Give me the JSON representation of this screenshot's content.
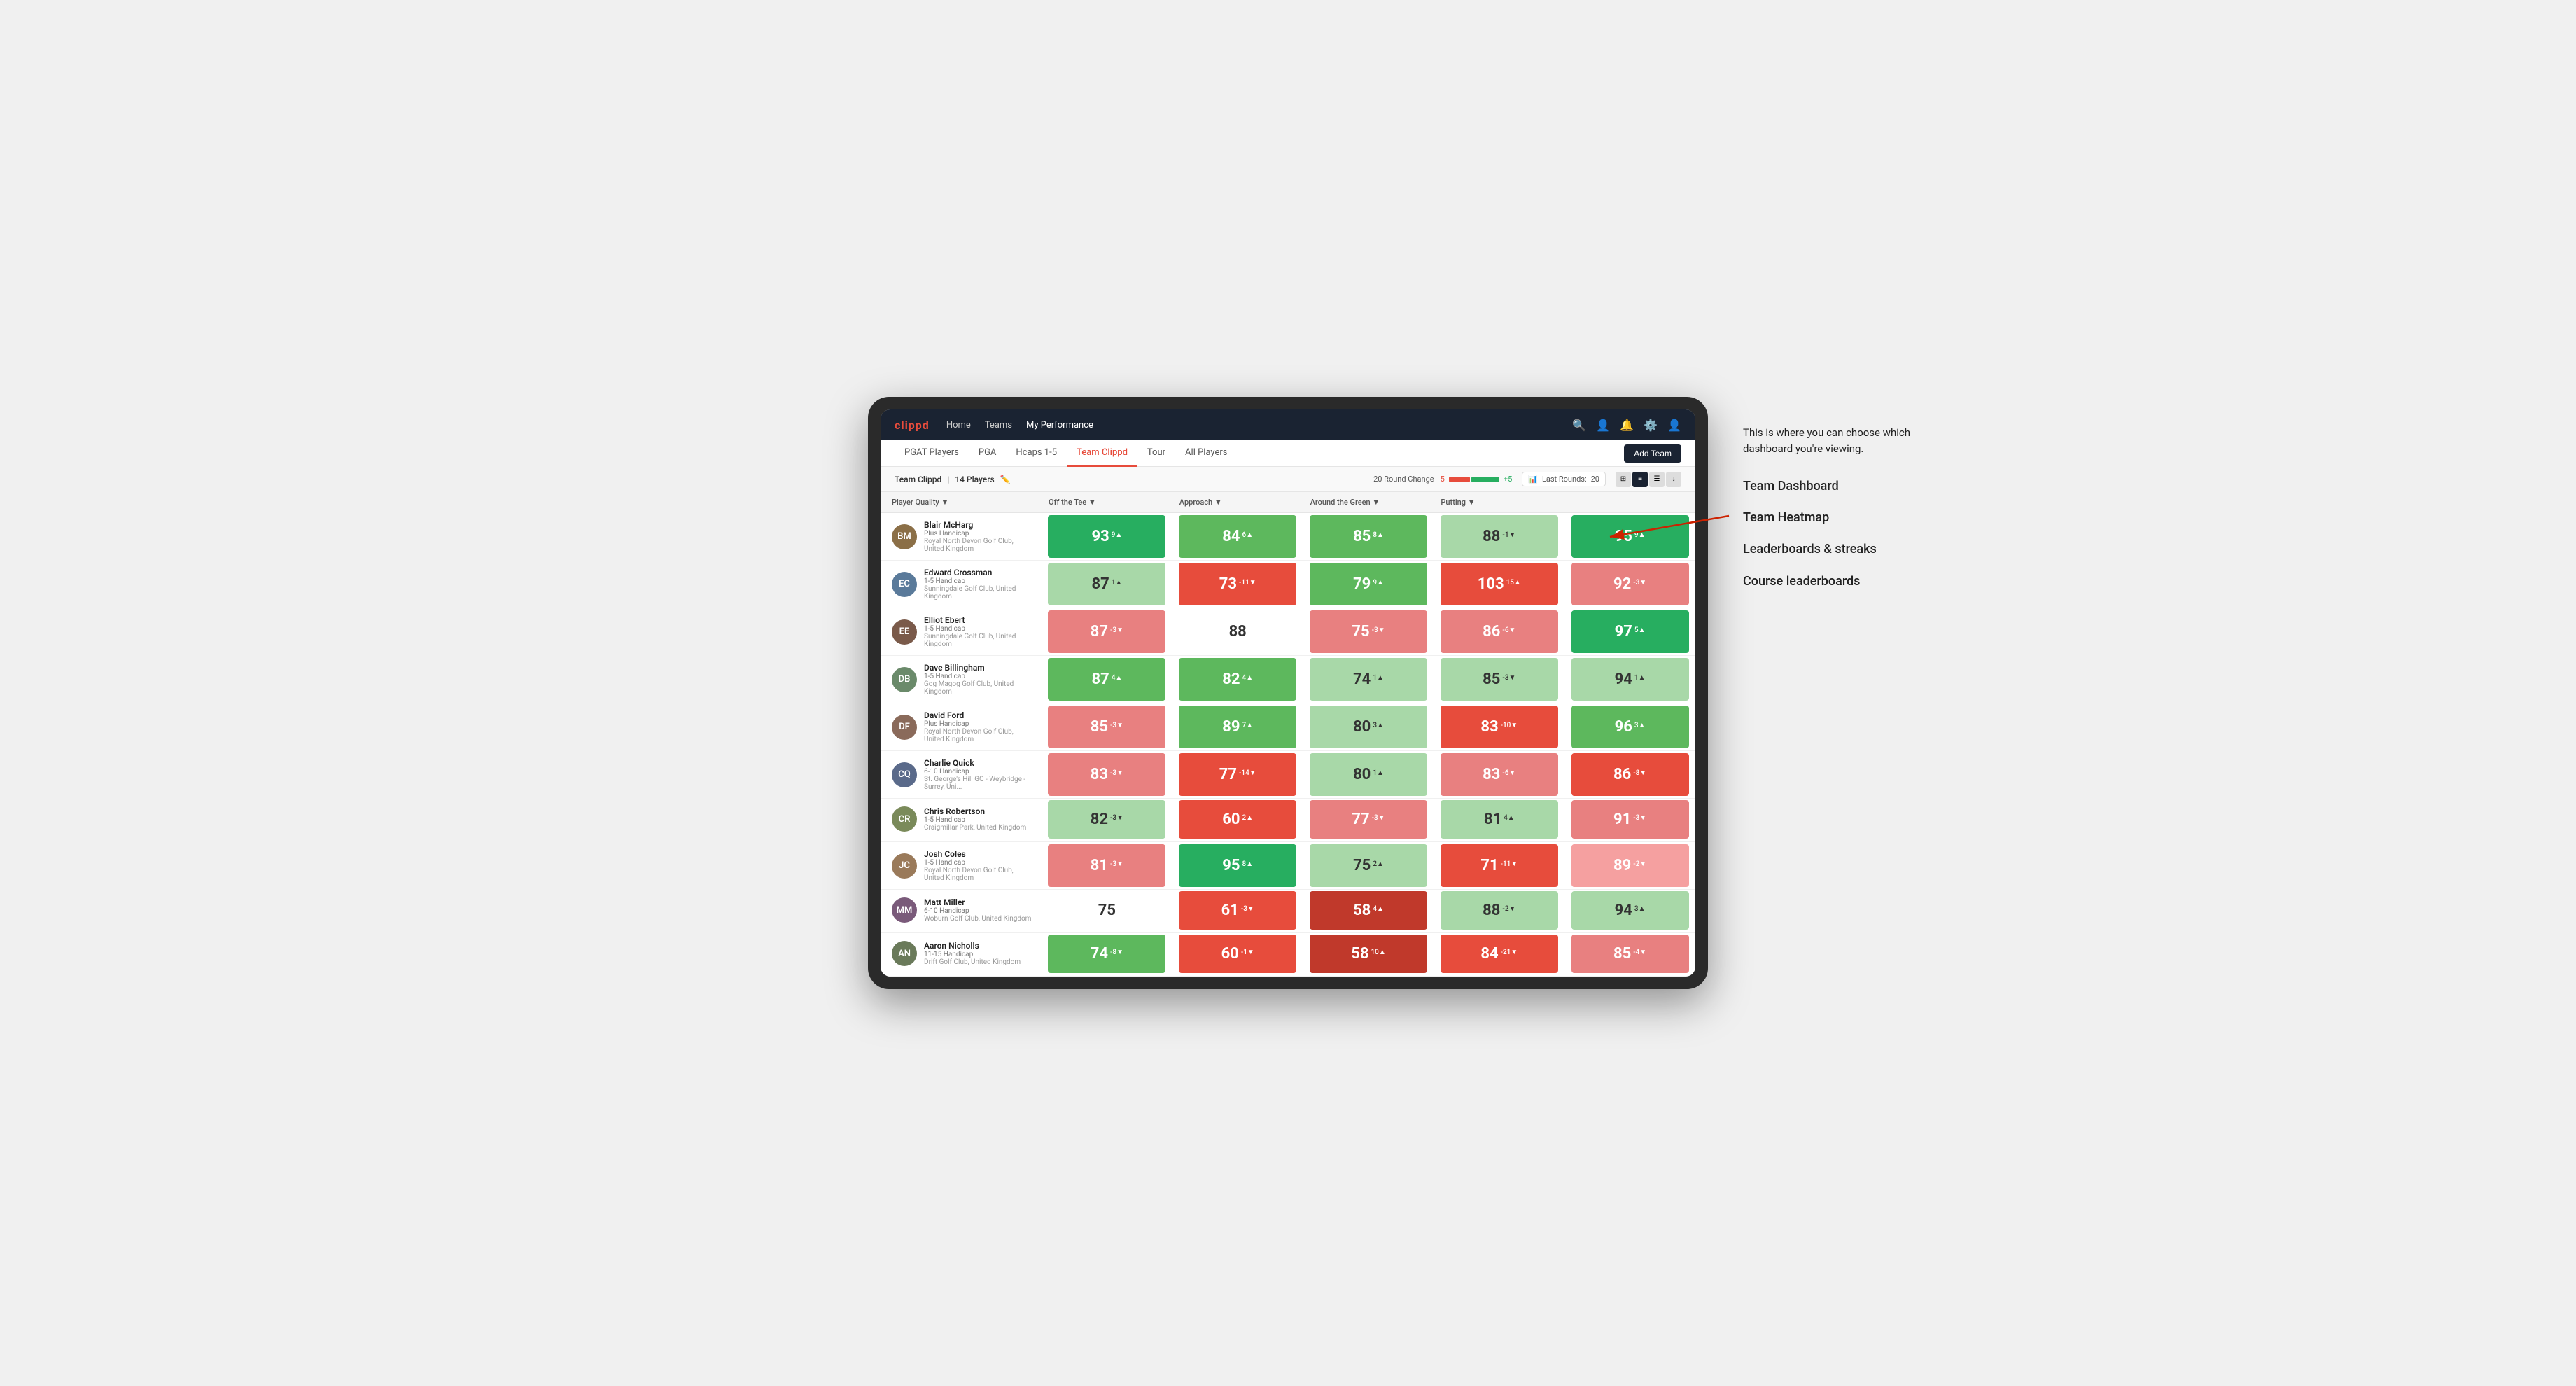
{
  "annotation": {
    "intro": "This is where you can choose which dashboard you're viewing.",
    "items": [
      "Team Dashboard",
      "Team Heatmap",
      "Leaderboards & streaks",
      "Course leaderboards"
    ]
  },
  "nav": {
    "logo": "clippd",
    "links": [
      "Home",
      "Teams",
      "My Performance"
    ],
    "active_link": "My Performance"
  },
  "subnav": {
    "links": [
      "PGAT Players",
      "PGA",
      "Hcaps 1-5",
      "Team Clippd",
      "Tour",
      "All Players"
    ],
    "active": "Team Clippd",
    "add_team_label": "Add Team"
  },
  "team_header": {
    "name": "Team Clippd",
    "separator": "|",
    "count": "14 Players",
    "round_change_label": "20 Round Change",
    "minus": "-5",
    "plus": "+5",
    "last_rounds_label": "Last Rounds:",
    "last_rounds_value": "20"
  },
  "table": {
    "columns": [
      "Player Quality ▼",
      "Off the Tee ▼",
      "Approach ▼",
      "Around the Green ▼",
      "Putting ▼"
    ],
    "rows": [
      {
        "name": "Blair McHarg",
        "hcp": "Plus Handicap",
        "club": "Royal North Devon Golf Club, United Kingdom",
        "initials": "BM",
        "color": "#8B6F47",
        "scores": [
          {
            "val": "93",
            "delta": "9",
            "dir": "up",
            "bg": "green-dark"
          },
          {
            "val": "84",
            "delta": "6",
            "dir": "up",
            "bg": "green-light"
          },
          {
            "val": "85",
            "delta": "8",
            "dir": "up",
            "bg": "green-light"
          },
          {
            "val": "88",
            "delta": "-1",
            "dir": "down",
            "bg": "green-pale"
          },
          {
            "val": "95",
            "delta": "9",
            "dir": "up",
            "bg": "green-dark"
          }
        ]
      },
      {
        "name": "Edward Crossman",
        "hcp": "1-5 Handicap",
        "club": "Sunningdale Golf Club, United Kingdom",
        "initials": "EC",
        "color": "#5a7a9a",
        "scores": [
          {
            "val": "87",
            "delta": "1",
            "dir": "up",
            "bg": "green-pale"
          },
          {
            "val": "73",
            "delta": "-11",
            "dir": "down",
            "bg": "red-dark"
          },
          {
            "val": "79",
            "delta": "9",
            "dir": "up",
            "bg": "green-light"
          },
          {
            "val": "103",
            "delta": "15",
            "dir": "up",
            "bg": "red-dark"
          },
          {
            "val": "92",
            "delta": "-3",
            "dir": "down",
            "bg": "red-light"
          }
        ]
      },
      {
        "name": "Elliot Ebert",
        "hcp": "1-5 Handicap",
        "club": "Sunningdale Golf Club, United Kingdom",
        "initials": "EE",
        "color": "#7a5a4a",
        "scores": [
          {
            "val": "87",
            "delta": "-3",
            "dir": "down",
            "bg": "red-light"
          },
          {
            "val": "88",
            "delta": "",
            "dir": "",
            "bg": "white-bg"
          },
          {
            "val": "75",
            "delta": "-3",
            "dir": "down",
            "bg": "red-light"
          },
          {
            "val": "86",
            "delta": "-6",
            "dir": "down",
            "bg": "red-light"
          },
          {
            "val": "97",
            "delta": "5",
            "dir": "up",
            "bg": "green-dark"
          }
        ]
      },
      {
        "name": "Dave Billingham",
        "hcp": "1-5 Handicap",
        "club": "Gog Magog Golf Club, United Kingdom",
        "initials": "DB",
        "color": "#6a8a6a",
        "scores": [
          {
            "val": "87",
            "delta": "4",
            "dir": "up",
            "bg": "green-light"
          },
          {
            "val": "82",
            "delta": "4",
            "dir": "up",
            "bg": "green-light"
          },
          {
            "val": "74",
            "delta": "1",
            "dir": "up",
            "bg": "green-pale"
          },
          {
            "val": "85",
            "delta": "-3",
            "dir": "down",
            "bg": "green-pale"
          },
          {
            "val": "94",
            "delta": "1",
            "dir": "up",
            "bg": "green-pale"
          }
        ]
      },
      {
        "name": "David Ford",
        "hcp": "Plus Handicap",
        "club": "Royal North Devon Golf Club, United Kingdom",
        "initials": "DF",
        "color": "#8a6a5a",
        "scores": [
          {
            "val": "85",
            "delta": "-3",
            "dir": "down",
            "bg": "red-light"
          },
          {
            "val": "89",
            "delta": "7",
            "dir": "up",
            "bg": "green-light"
          },
          {
            "val": "80",
            "delta": "3",
            "dir": "up",
            "bg": "green-pale"
          },
          {
            "val": "83",
            "delta": "-10",
            "dir": "down",
            "bg": "red-dark"
          },
          {
            "val": "96",
            "delta": "3",
            "dir": "up",
            "bg": "green-light"
          }
        ]
      },
      {
        "name": "Charlie Quick",
        "hcp": "6-10 Handicap",
        "club": "St. George's Hill GC - Weybridge - Surrey, Uni...",
        "initials": "CQ",
        "color": "#5a6a8a",
        "scores": [
          {
            "val": "83",
            "delta": "-3",
            "dir": "down",
            "bg": "red-light"
          },
          {
            "val": "77",
            "delta": "-14",
            "dir": "down",
            "bg": "red-dark"
          },
          {
            "val": "80",
            "delta": "1",
            "dir": "up",
            "bg": "green-pale"
          },
          {
            "val": "83",
            "delta": "-6",
            "dir": "down",
            "bg": "red-light"
          },
          {
            "val": "86",
            "delta": "-8",
            "dir": "down",
            "bg": "red-dark"
          }
        ]
      },
      {
        "name": "Chris Robertson",
        "hcp": "1-5 Handicap",
        "club": "Craigmillar Park, United Kingdom",
        "initials": "CR",
        "color": "#7a8a5a",
        "scores": [
          {
            "val": "82",
            "delta": "-3",
            "dir": "down",
            "bg": "green-pale"
          },
          {
            "val": "60",
            "delta": "2",
            "dir": "up",
            "bg": "red-dark"
          },
          {
            "val": "77",
            "delta": "-3",
            "dir": "down",
            "bg": "red-light"
          },
          {
            "val": "81",
            "delta": "4",
            "dir": "up",
            "bg": "green-pale"
          },
          {
            "val": "91",
            "delta": "-3",
            "dir": "down",
            "bg": "red-light"
          }
        ]
      },
      {
        "name": "Josh Coles",
        "hcp": "1-5 Handicap",
        "club": "Royal North Devon Golf Club, United Kingdom",
        "initials": "JC",
        "color": "#9a7a5a",
        "scores": [
          {
            "val": "81",
            "delta": "-3",
            "dir": "down",
            "bg": "red-light"
          },
          {
            "val": "95",
            "delta": "8",
            "dir": "up",
            "bg": "green-dark"
          },
          {
            "val": "75",
            "delta": "2",
            "dir": "up",
            "bg": "green-pale"
          },
          {
            "val": "71",
            "delta": "-11",
            "dir": "down",
            "bg": "red-dark"
          },
          {
            "val": "89",
            "delta": "-2",
            "dir": "down",
            "bg": "pink-light"
          }
        ]
      },
      {
        "name": "Matt Miller",
        "hcp": "6-10 Handicap",
        "club": "Woburn Golf Club, United Kingdom",
        "initials": "MM",
        "color": "#7a5a7a",
        "scores": [
          {
            "val": "75",
            "delta": "",
            "dir": "",
            "bg": "white-bg"
          },
          {
            "val": "61",
            "delta": "-3",
            "dir": "down",
            "bg": "red-dark"
          },
          {
            "val": "58",
            "delta": "4",
            "dir": "up",
            "bg": "red-deeper"
          },
          {
            "val": "88",
            "delta": "-2",
            "dir": "down",
            "bg": "green-pale"
          },
          {
            "val": "94",
            "delta": "3",
            "dir": "up",
            "bg": "green-pale"
          }
        ]
      },
      {
        "name": "Aaron Nicholls",
        "hcp": "11-15 Handicap",
        "club": "Drift Golf Club, United Kingdom",
        "initials": "AN",
        "color": "#6a7a5a",
        "scores": [
          {
            "val": "74",
            "delta": "-8",
            "dir": "down",
            "bg": "green-light"
          },
          {
            "val": "60",
            "delta": "-1",
            "dir": "down",
            "bg": "red-dark"
          },
          {
            "val": "58",
            "delta": "10",
            "dir": "up",
            "bg": "red-deeper"
          },
          {
            "val": "84",
            "delta": "-21",
            "dir": "down",
            "bg": "red-dark"
          },
          {
            "val": "85",
            "delta": "-4",
            "dir": "down",
            "bg": "red-light"
          }
        ]
      }
    ]
  }
}
